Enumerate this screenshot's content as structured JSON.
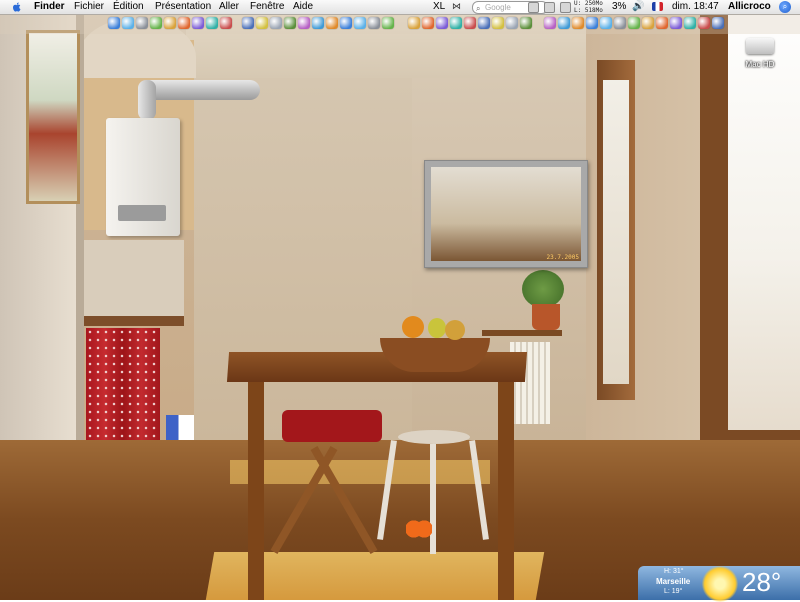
{
  "menubar": {
    "app_name": "Finder",
    "menus": [
      "Fichier",
      "Édition",
      "Présentation",
      "Aller",
      "Fenêtre",
      "Aide"
    ],
    "input_indicator": "XL",
    "search_placeholder": "Google",
    "memory_used": "U: 250Mo",
    "memory_free": "L: 518Mo",
    "battery": "3%",
    "clock": "dim. 18:47",
    "user": "Allicroco"
  },
  "toolbar": {
    "icons": [
      "finder-icon",
      "safari-icon",
      "mail-icon",
      "ichat-icon",
      "itunes-icon",
      "iphoto-icon",
      "ical-icon",
      "address-book-icon",
      "system-prefs-icon",
      "app-icon",
      "app-icon",
      "app-icon",
      "app-icon",
      "app-icon",
      "app-icon",
      "app-icon",
      "app-icon",
      "app-icon",
      "app-icon",
      "app-icon",
      "app-icon",
      "app-icon",
      "app-icon",
      "app-icon",
      "app-icon",
      "app-icon",
      "app-icon",
      "app-icon",
      "app-icon",
      "app-icon",
      "app-icon",
      "app-icon",
      "app-icon",
      "app-icon",
      "app-icon",
      "app-icon",
      "app-icon",
      "app-icon",
      "app-icon",
      "app-icon",
      "app-icon",
      "app-icon"
    ]
  },
  "desktop": {
    "drive_label": "Mac HD"
  },
  "photo_widget": {
    "date": "23.7.2005"
  },
  "weather": {
    "high": "H: 31°",
    "city": "Marseille",
    "low": "L: 19°",
    "temperature": "28°"
  },
  "colors": {
    "menubar_bg": "#ededed",
    "weather_bg": "#5b8fc8"
  }
}
